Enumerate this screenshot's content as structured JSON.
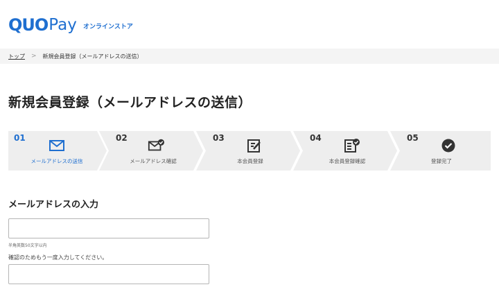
{
  "header": {
    "logo_quo": "QUO",
    "logo_pay": "Pay",
    "store_label": "オンラインストア"
  },
  "breadcrumb": {
    "top_label": "トップ",
    "separator": ">",
    "current_label": "新規会員登録（メールアドレスの送信）"
  },
  "page_title": "新規会員登録（メールアドレスの送信）",
  "steps": [
    {
      "number": "01",
      "label": "メールアドレスの送信",
      "icon": "envelope-icon",
      "active": true
    },
    {
      "number": "02",
      "label": "メールアドレス確認",
      "icon": "envelope-check-icon",
      "active": false
    },
    {
      "number": "03",
      "label": "本会員登録",
      "icon": "form-edit-icon",
      "active": false
    },
    {
      "number": "04",
      "label": "本会員登録確認",
      "icon": "form-check-icon",
      "active": false
    },
    {
      "number": "05",
      "label": "登録完了",
      "icon": "check-circle-icon",
      "active": false
    }
  ],
  "form": {
    "section_title": "メールアドレスの入力",
    "email_value": "",
    "email_placeholder": "",
    "hint": "半角英数50文字以内",
    "confirm_label": "確認のためもう一度入力してください。",
    "confirm_value": "",
    "confirm_placeholder": ""
  },
  "colors": {
    "accent": "#1f6fd0",
    "step_bg": "#eeeeee",
    "breadcrumb_bg": "#f4f4f4"
  }
}
